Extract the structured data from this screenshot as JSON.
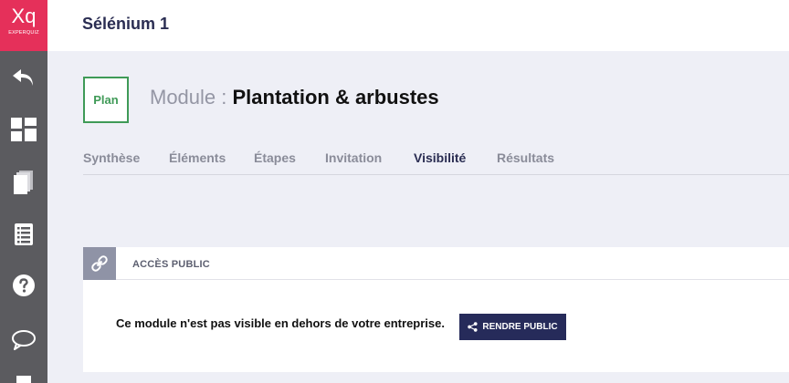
{
  "app": {
    "logo_mark": "Xq",
    "logo_sub": "EXPERQUIZ",
    "brand_color": "#e5305a"
  },
  "sidebar": {
    "items": [
      {
        "icon": "back-arrow-icon"
      },
      {
        "icon": "dashboard-icon"
      },
      {
        "icon": "pages-icon"
      },
      {
        "icon": "list-icon"
      },
      {
        "icon": "help-icon"
      },
      {
        "icon": "chat-icon"
      }
    ]
  },
  "header": {
    "title": "Sélénium 1"
  },
  "module": {
    "badge": "Plan",
    "prefix": "Module : ",
    "name": "Plantation & arbustes"
  },
  "tabs": [
    {
      "label": "Synthèse",
      "active": false
    },
    {
      "label": "Éléments",
      "active": false
    },
    {
      "label": "Étapes",
      "active": false
    },
    {
      "label": "Invitation",
      "active": false
    },
    {
      "label": "Visibilité",
      "active": true
    },
    {
      "label": "Résultats",
      "active": false
    }
  ],
  "public_access": {
    "heading": "ACCÈS PUBLIC",
    "message": "Ce module n'est pas visible en dehors de votre entreprise.",
    "button_label": "RENDRE PUBLIC",
    "button_icon": "share-icon"
  }
}
